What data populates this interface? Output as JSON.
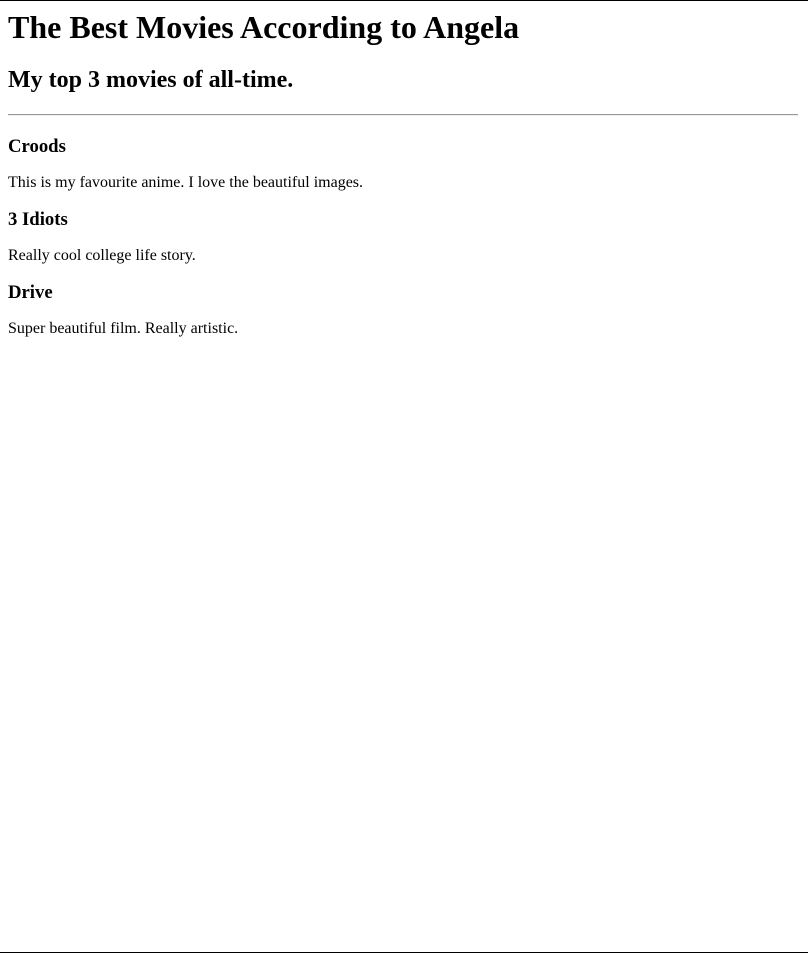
{
  "page": {
    "title": "The Best Movies According to Angela",
    "subtitle": "My top 3 movies of all-time."
  },
  "movies": [
    {
      "title": "Croods",
      "description": "This is my favourite anime. I love the beautiful images."
    },
    {
      "title": "3 Idiots",
      "description": "Really cool college life story."
    },
    {
      "title": "Drive",
      "description": "Super beautiful film. Really artistic."
    }
  ]
}
